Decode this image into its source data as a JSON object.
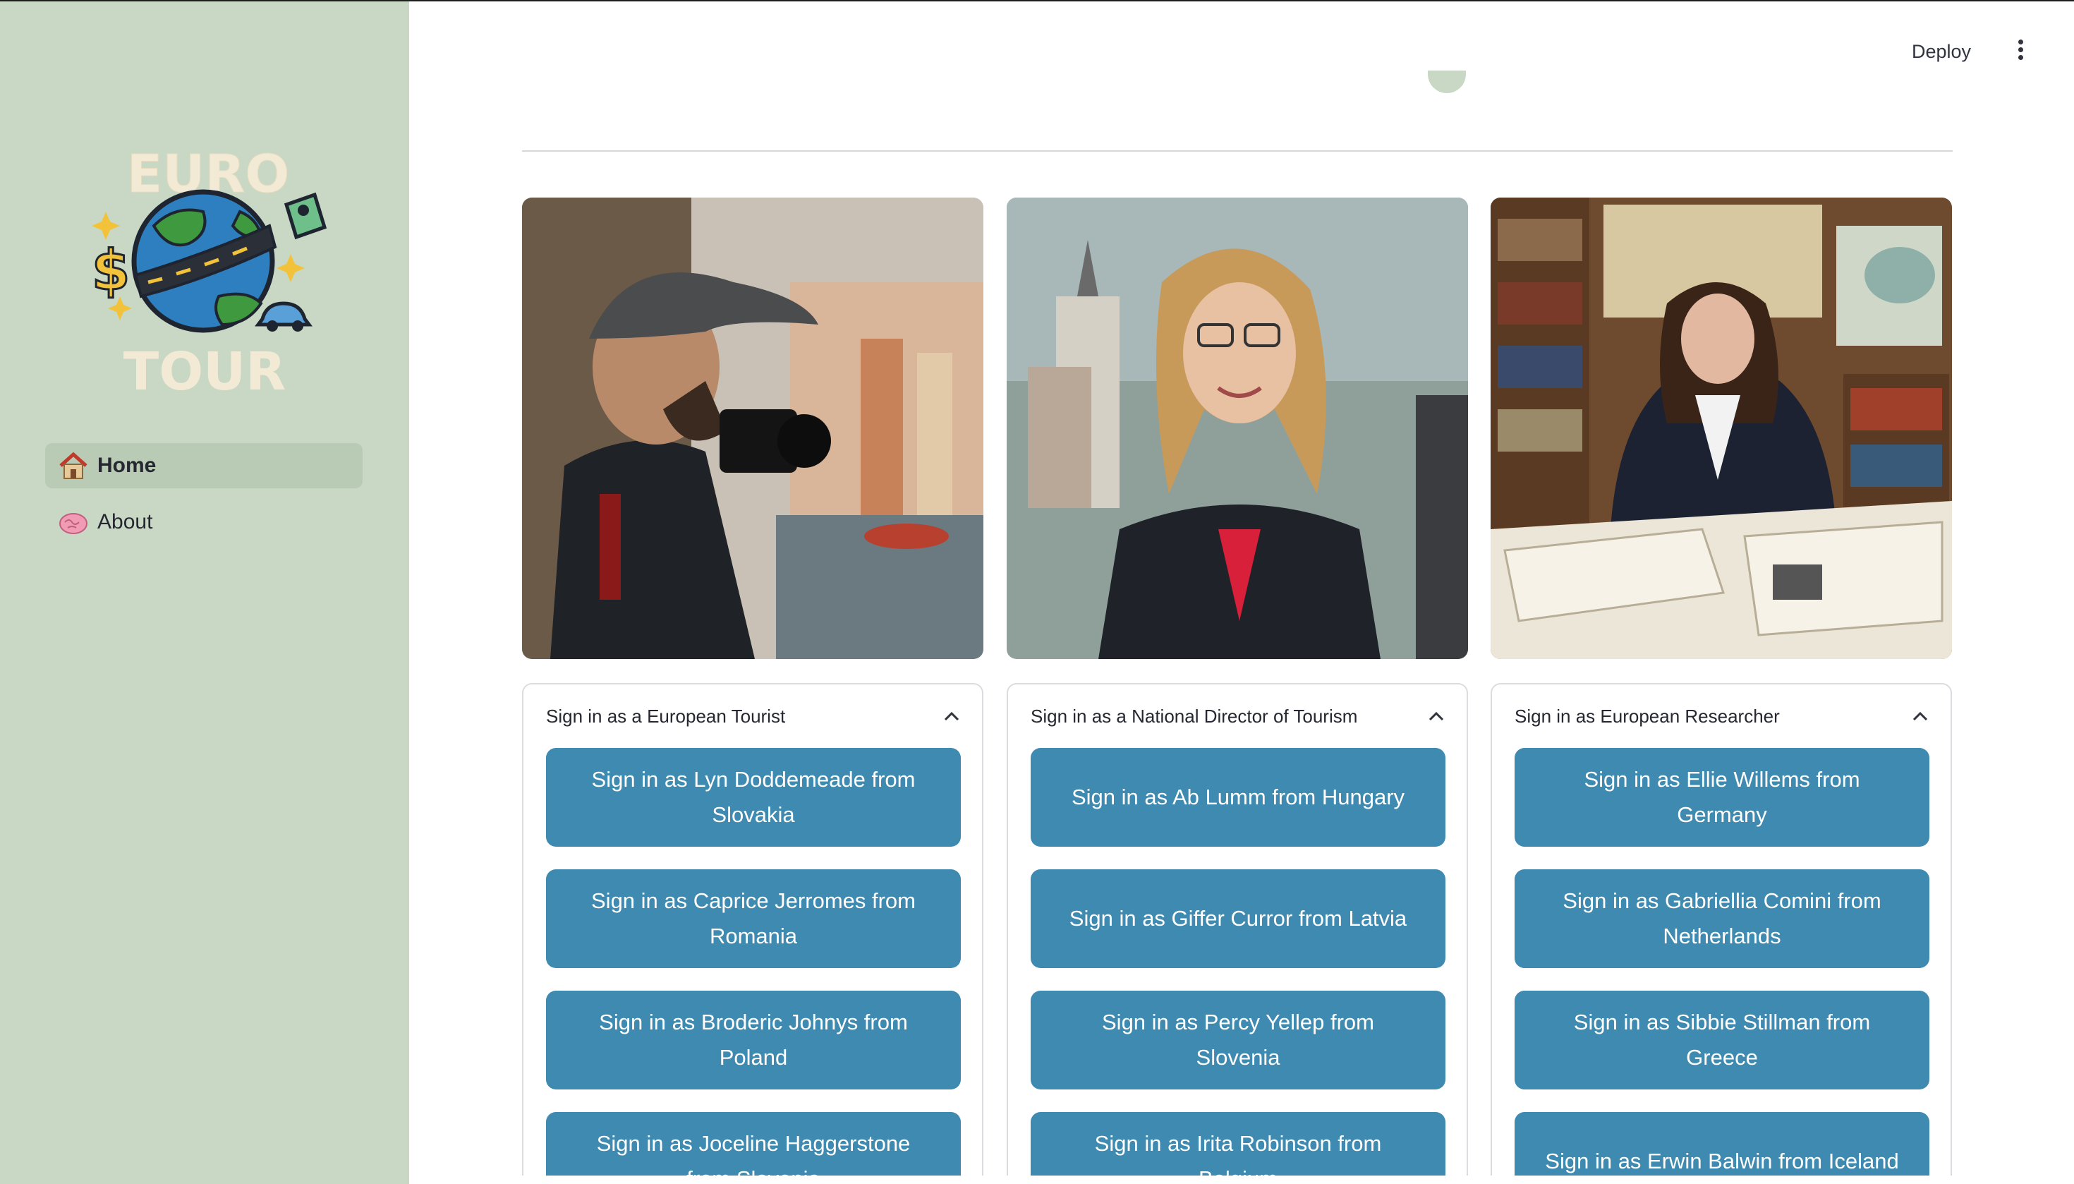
{
  "sidebar": {
    "logo_text_top": "EURO",
    "logo_text_bottom": "TOUR",
    "items": [
      {
        "icon": "house-icon",
        "label": "Home",
        "active": true
      },
      {
        "icon": "brain-icon",
        "label": "About",
        "active": false
      }
    ]
  },
  "header": {
    "deploy_label": "Deploy",
    "menu_icon": "vertical-dots-icon"
  },
  "columns": [
    {
      "photo": "tourist-photographer-photo",
      "expander_title": "Sign in as a European Tourist",
      "buttons": [
        "Sign in as Lyn Doddemeade from Slovakia",
        "Sign in as Caprice Jerromes from Romania",
        "Sign in as Broderic Johnys from Poland",
        "Sign in as Joceline Haggerstone from Slovenia"
      ]
    },
    {
      "photo": "director-of-tourism-photo",
      "expander_title": "Sign in as a National Director of Tourism",
      "buttons": [
        "Sign in as Ab Lumm from Hungary",
        "Sign in as Giffer Curror from Latvia",
        "Sign in as Percy Yellep from Slovenia",
        "Sign in as Irita Robinson from Belgium"
      ]
    },
    {
      "photo": "researcher-library-photo",
      "expander_title": "Sign in as European Researcher",
      "buttons": [
        "Sign in as Ellie Willems from Germany",
        "Sign in as Gabriellia Comini from Netherlands",
        "Sign in as Sibbie Stillman from Greece",
        "Sign in as Erwin Balwin from Iceland"
      ]
    }
  ],
  "colors": {
    "sidebar_bg": "#c8d8c4",
    "button_bg": "#3e8ab0",
    "button_text": "#ffffff"
  }
}
